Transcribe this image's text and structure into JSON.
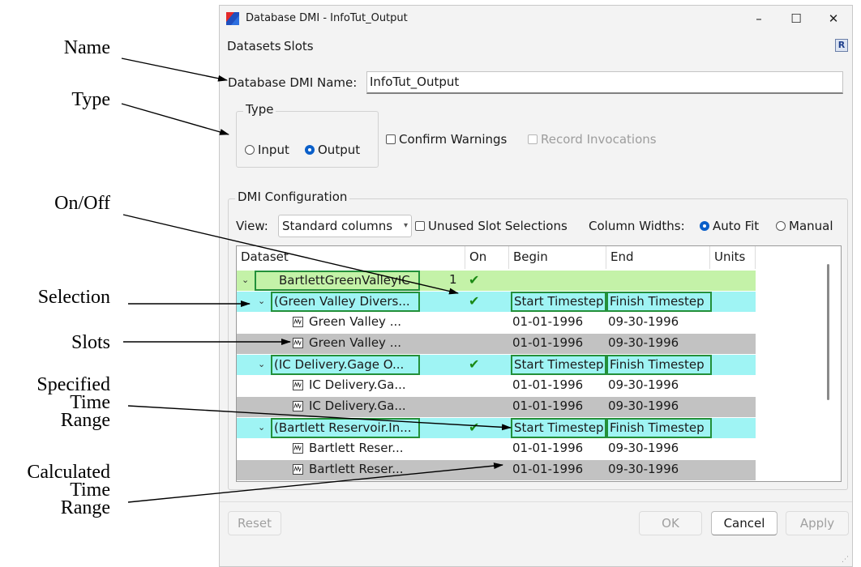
{
  "annotations": [
    {
      "label": "Name"
    },
    {
      "label": "Type"
    },
    {
      "label": "On/Off"
    },
    {
      "label": "Selection"
    },
    {
      "label": "Slots"
    },
    {
      "label": "Specified\nTime\nRange"
    },
    {
      "label": "Calculated\nTime\nRange"
    }
  ],
  "window": {
    "title": "Database DMI - InfoTut_Output",
    "minimize": "–",
    "maximize": "☐",
    "close": "✕"
  },
  "menu": {
    "items": [
      "Datasets",
      "Slots"
    ]
  },
  "name_field": {
    "label": "Database DMI Name:",
    "value": "InfoTut_Output"
  },
  "type_group": {
    "title": "Type",
    "input_label": "Input",
    "output_label": "Output",
    "selected": "Output"
  },
  "options": {
    "confirm_warnings": "Confirm Warnings",
    "record_invocations": "Record Invocations"
  },
  "config": {
    "title": "DMI Configuration",
    "view_label": "View:",
    "view_value": "Standard columns",
    "unused_label": "Unused Slot Selections",
    "widths_label": "Column Widths:",
    "auto_fit": "Auto Fit",
    "manual": "Manual",
    "widths_selected": "Auto Fit"
  },
  "table": {
    "columns": [
      "Dataset",
      "On",
      "Begin",
      "End",
      "Units"
    ],
    "rows": [
      {
        "kind": "dataset",
        "name": "BartlettGreenValleyIC",
        "count": "1",
        "on": "✔",
        "begin": "",
        "end": "",
        "bg": "green"
      },
      {
        "kind": "selection",
        "name": "(Green Valley Divers...",
        "on": "✔",
        "begin": "Start Timestep",
        "end": "Finish Timestep",
        "bg": "cyan"
      },
      {
        "kind": "slot",
        "name": "Green Valley ...",
        "on": "",
        "begin": "01-01-1996",
        "end": "09-30-1996",
        "bg": "white"
      },
      {
        "kind": "slot",
        "name": "Green Valley ...",
        "on": "",
        "begin": "01-01-1996",
        "end": "09-30-1996",
        "bg": "gray"
      },
      {
        "kind": "selection",
        "name": "(IC Delivery.Gage O...",
        "on": "✔",
        "begin": "Start Timestep",
        "end": "Finish Timestep",
        "bg": "cyan"
      },
      {
        "kind": "slot",
        "name": "IC Delivery.Ga...",
        "on": "",
        "begin": "01-01-1996",
        "end": "09-30-1996",
        "bg": "white"
      },
      {
        "kind": "slot",
        "name": "IC Delivery.Ga...",
        "on": "",
        "begin": "01-01-1996",
        "end": "09-30-1996",
        "bg": "gray"
      },
      {
        "kind": "selection",
        "name": "(Bartlett Reservoir.In...",
        "on": "✔",
        "begin": "Start Timestep",
        "end": "Finish Timestep",
        "bg": "cyan"
      },
      {
        "kind": "slot",
        "name": "Bartlett Reser...",
        "on": "",
        "begin": "01-01-1996",
        "end": "09-30-1996",
        "bg": "white"
      },
      {
        "kind": "slot",
        "name": "Bartlett Reser...",
        "on": "",
        "begin": "01-01-1996",
        "end": "09-30-1996",
        "bg": "gray"
      }
    ]
  },
  "buttons": {
    "reset": "Reset",
    "ok": "OK",
    "cancel": "Cancel",
    "apply": "Apply"
  },
  "colors": {
    "accent": "#0a5fc9",
    "dataset_row": "#c4f2a8",
    "selection_row": "#9ff4f4",
    "slot_alt_row": "#c2c2c2",
    "cell_border": "#23903a",
    "check": "#1b8a16"
  }
}
